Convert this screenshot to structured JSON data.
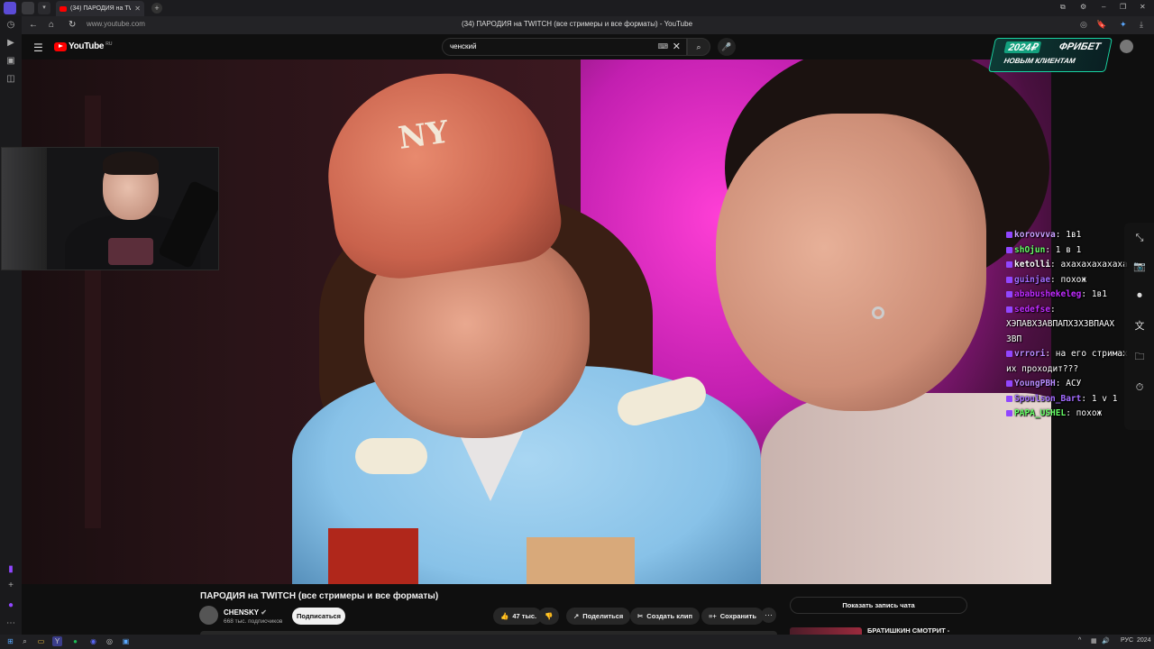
{
  "browser": {
    "tab_title": "(34) ПАРОДИЯ на TWITCH (в",
    "url": "www.youtube.com",
    "page_title": "(34) ПАРОДИЯ на TWITCH (все стримеры и все форматы) - YouTube"
  },
  "youtube": {
    "logo_text": "YouTube",
    "region": "RU",
    "search_query": "ченский"
  },
  "ad": {
    "amount": "2024₽",
    "brand": "ФРИБЕТ",
    "tagline": "НОВЫМ КЛИЕНТАМ"
  },
  "video": {
    "cap_logo": "NY",
    "title": "ПАРОДИЯ на TWITCH (все стримеры и все форматы)",
    "channel": "CHENSKY",
    "subscribers": "668 тыс. подписчиков",
    "subscribe_label": "Подписаться",
    "likes": "47 тыс.",
    "share_label": "Поделиться",
    "clip_label": "Создать клип",
    "save_label": "Сохранить",
    "show_chat_label": "Показать запись чата",
    "recommended_title": "БРАТИШКИН СМОТРИТ -"
  },
  "chat": [
    {
      "user": "korovvva",
      "text": "1в1",
      "color": "#c9a0ff"
    },
    {
      "user": "shOjun",
      "text": "1 в 1",
      "color": "#66ff66"
    },
    {
      "user": "ketolli",
      "text": "ахахахахахаха",
      "color": "#ffffff"
    },
    {
      "user": "guinjae",
      "text": "похож",
      "color": "#a26bff"
    },
    {
      "user": "ababushekeleg",
      "text": "1в1",
      "color": "#c02bff"
    },
    {
      "user": "sedefse",
      "text": "",
      "color": "#c02bff"
    },
    {
      "user": "",
      "text": "ХЭПАВХЗАВПАПХЗХЗВПААХ",
      "color": "#ffffff"
    },
    {
      "user": "",
      "text": "ЗВП",
      "color": "#ffffff"
    },
    {
      "user": "vrrori",
      "text": "на его стримах",
      "color": "#b88cff"
    },
    {
      "user": "",
      "text": "их проходит???",
      "color": "#ffffff"
    },
    {
      "user": "YoungPBH",
      "text": "АСУ",
      "color": "#b88cff"
    },
    {
      "user": "Spoulson_Bart",
      "text": "1 v 1",
      "color": "#a26bff"
    },
    {
      "user": "PAPA_USHEL",
      "text": "похож",
      "color": "#66ff66"
    }
  ],
  "taskbar": {
    "lang": "РУС",
    "year": "2024"
  }
}
